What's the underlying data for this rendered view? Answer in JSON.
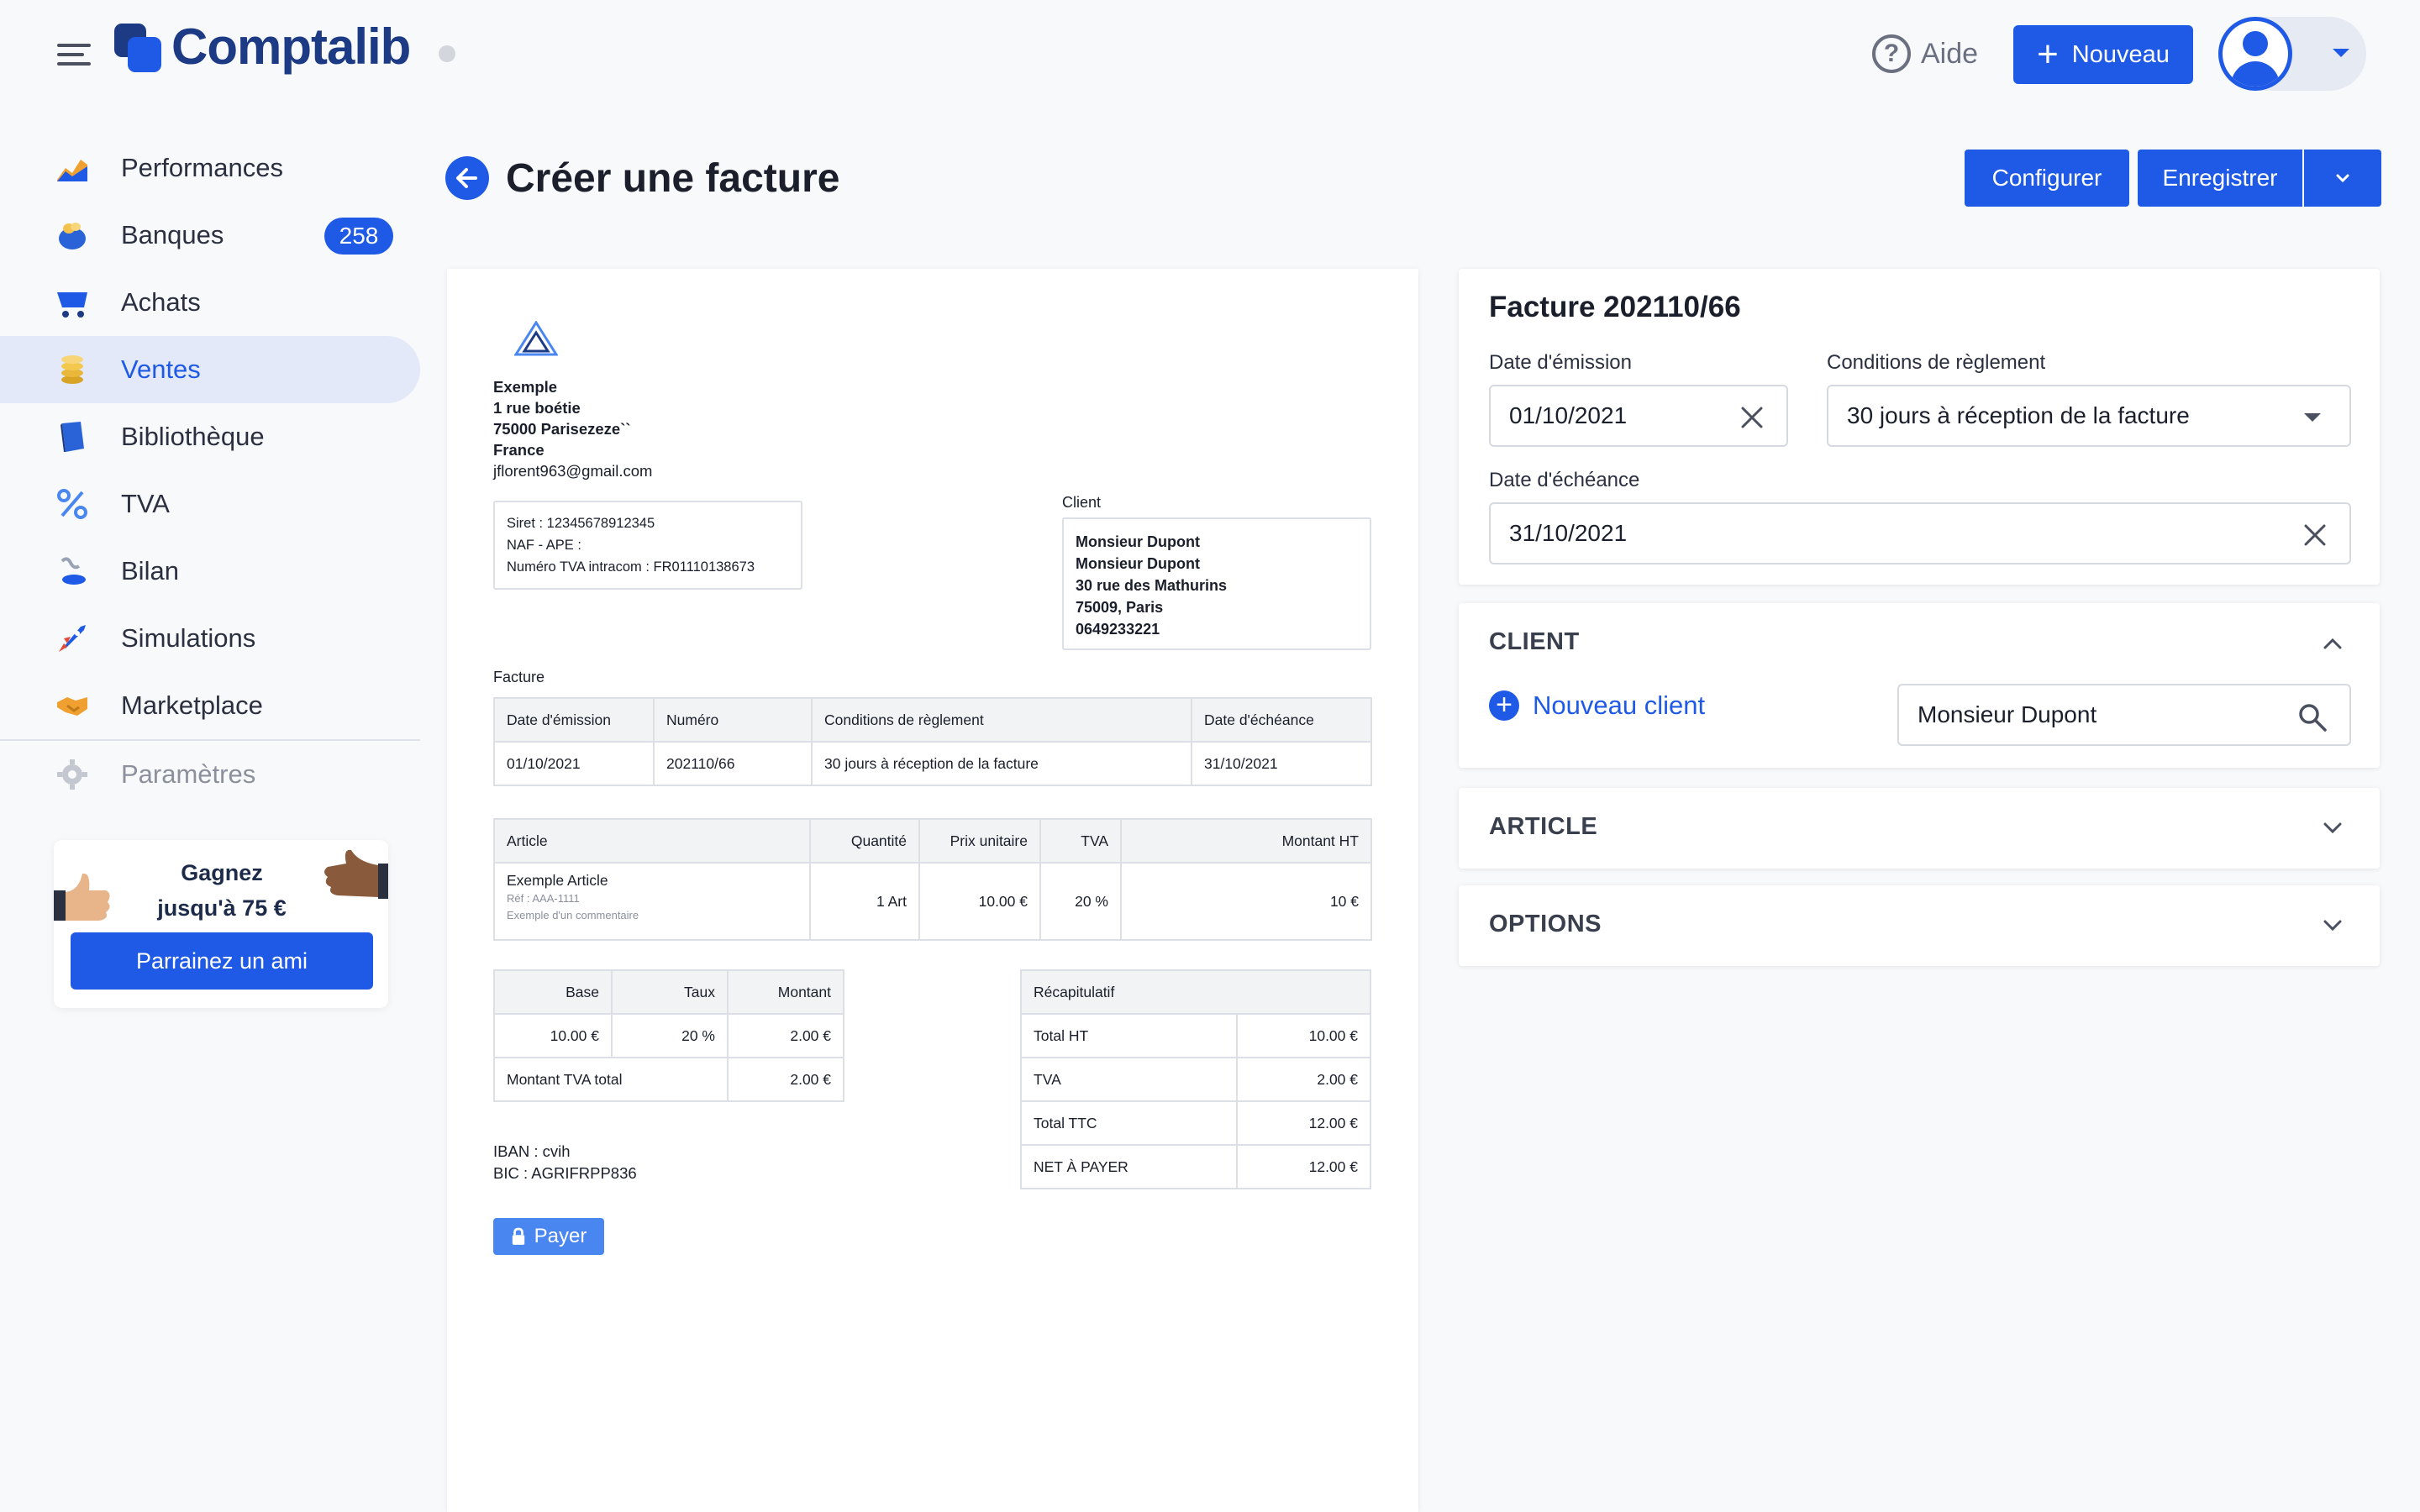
{
  "header": {
    "logo_text": "Comptalib",
    "help_label": "Aide",
    "new_button_label": "Nouveau",
    "brand_color": "#1f5ae6"
  },
  "sidebar": {
    "items": [
      {
        "label": "Performances",
        "icon": "chart-icon"
      },
      {
        "label": "Banques",
        "icon": "bank-icon",
        "badge": "258"
      },
      {
        "label": "Achats",
        "icon": "cart-icon"
      },
      {
        "label": "Ventes",
        "icon": "coins-icon",
        "active": true
      },
      {
        "label": "Bibliothèque",
        "icon": "book-icon"
      },
      {
        "label": "TVA",
        "icon": "percent-icon"
      },
      {
        "label": "Bilan",
        "icon": "scale-icon"
      },
      {
        "label": "Simulations",
        "icon": "rocket-icon"
      },
      {
        "label": "Marketplace",
        "icon": "handshake-icon"
      },
      {
        "label": "Paramètres",
        "icon": "gear-icon"
      }
    ],
    "promo": {
      "line1": "Gagnez",
      "line2": "jusqu'à 75 €",
      "button": "Parrainez un ami"
    }
  },
  "page": {
    "title": "Créer une facture",
    "configure_label": "Configurer",
    "save_label": "Enregistrer"
  },
  "invoice": {
    "company": {
      "name": "Exemple",
      "street": "1 rue boétie",
      "city": "75000 Parisezeze``",
      "country": "France",
      "email": "jflorent963@gmail.com"
    },
    "legal": {
      "siret": "Siret : 12345678912345",
      "naf": "NAF - APE :",
      "tva": "Numéro TVA intracom : FR01110138673"
    },
    "client_label": "Client",
    "client": {
      "line1": "Monsieur Dupont",
      "line2": "Monsieur Dupont",
      "line3": "30 rue des Mathurins",
      "line4": "75009, Paris",
      "line5": "0649233221"
    },
    "facture_label": "Facture",
    "meta_headers": [
      "Date d'émission",
      "Numéro",
      "Conditions de règlement",
      "Date d'échéance"
    ],
    "meta_values": [
      "01/10/2021",
      "202110/66",
      "30 jours à réception de la facture",
      "31/10/2021"
    ],
    "article_headers": [
      "Article",
      "Quantité",
      "Prix unitaire",
      "TVA",
      "Montant HT"
    ],
    "article": {
      "name": "Exemple Article",
      "ref": "Réf : AAA-1111",
      "comment": "Exemple d'un commentaire",
      "qty": "1 Art",
      "unit_price": "10.00 €",
      "tva": "20 %",
      "amount": "10 €"
    },
    "tva_headers": [
      "Base",
      "Taux",
      "Montant"
    ],
    "tva_row": [
      "10.00 €",
      "20 %",
      "2.00 €"
    ],
    "tva_total_label": "Montant TVA total",
    "tva_total_value": "2.00 €",
    "recap_title": "Récapitulatif",
    "recap": [
      {
        "label": "Total HT",
        "value": "10.00 €"
      },
      {
        "label": "TVA",
        "value": "2.00 €"
      },
      {
        "label": "Total TTC",
        "value": "12.00 €"
      },
      {
        "label": "NET À PAYER",
        "value": "12.00 €"
      }
    ],
    "iban": "IBAN : cvih",
    "bic": "BIC : AGRIFRPP836",
    "pay_label": "Payer"
  },
  "form": {
    "title": "Facture 202110/66",
    "date_emission_label": "Date d'émission",
    "date_emission_value": "01/10/2021",
    "conditions_label": "Conditions de règlement",
    "conditions_value": "30 jours à réception de la facture",
    "date_echeance_label": "Date d'échéance",
    "date_echeance_value": "31/10/2021",
    "client_section": "CLIENT",
    "new_client_label": "Nouveau client",
    "client_search_value": "Monsieur Dupont",
    "article_section": "ARTICLE",
    "options_section": "OPTIONS"
  }
}
